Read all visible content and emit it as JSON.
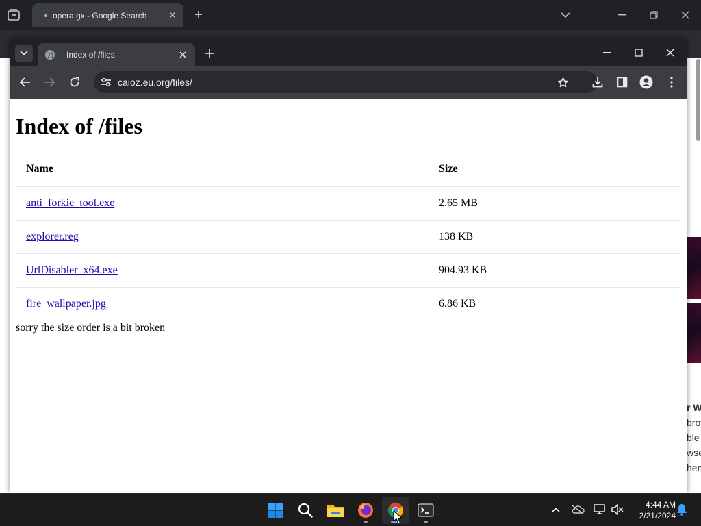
{
  "background_browser": {
    "tab_title": "opera gx - Google Search",
    "right_edge_text": [
      "r W",
      "brov",
      "ble",
      "wser",
      "hem"
    ]
  },
  "browser": {
    "tab_title": "Index of /files",
    "url": "caioz.eu.org/files/"
  },
  "page": {
    "heading": "Index of /files",
    "columns": [
      "Name",
      "Size"
    ],
    "files": [
      {
        "name": "anti_forkie_tool.exe",
        "size": "2.65 MB"
      },
      {
        "name": "explorer.reg",
        "size": "138 KB"
      },
      {
        "name": "UrlDisabler_x64.exe",
        "size": "904.93 KB"
      },
      {
        "name": "fire_wallpaper.jpg",
        "size": "6.86 KB"
      }
    ],
    "note": "sorry the size order is a bit broken"
  },
  "taskbar": {
    "apps": [
      "start-icon",
      "search-icon",
      "file-explorer-icon",
      "firefox-icon",
      "chrome-icon",
      "terminal-icon"
    ],
    "time": "4:44 AM",
    "date": "2/21/2024"
  },
  "colors": {
    "tab_active": "#3c3d41",
    "toolbar": "#3c3d41",
    "omnibox": "#282a2d",
    "link": "#1a0dab",
    "accent": "#5aa7ff"
  }
}
